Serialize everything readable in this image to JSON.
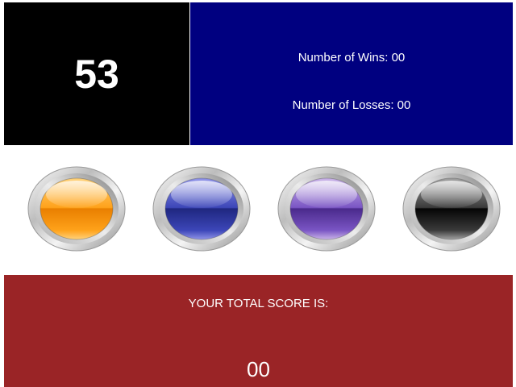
{
  "colors": {
    "target_bg": "#000000",
    "stats_bg": "#000080",
    "score_bg": "#9a2426",
    "text": "#ffffff"
  },
  "target": {
    "number": "53"
  },
  "stats": {
    "wins": "Number of Wins: 00",
    "losses": "Number of Losses: 00"
  },
  "gems": [
    {
      "name": "orange-gem-button",
      "color": "orange",
      "light": "#ffd27a",
      "mid": "#ffa21a",
      "dark": "#e97f00"
    },
    {
      "name": "blue-gem-button",
      "color": "blue",
      "light": "#8f93e8",
      "mid": "#3c46b8",
      "dark": "#1f2780"
    },
    {
      "name": "purple-gem-button",
      "color": "purple",
      "light": "#c9b3e8",
      "mid": "#7a55c4",
      "dark": "#4a2a8c"
    },
    {
      "name": "black-gem-button",
      "color": "black",
      "light": "#a0a0a0",
      "mid": "#3a3a3a",
      "dark": "#050505"
    }
  ],
  "score": {
    "label": "YOUR TOTAL SCORE IS:",
    "value": "00"
  }
}
